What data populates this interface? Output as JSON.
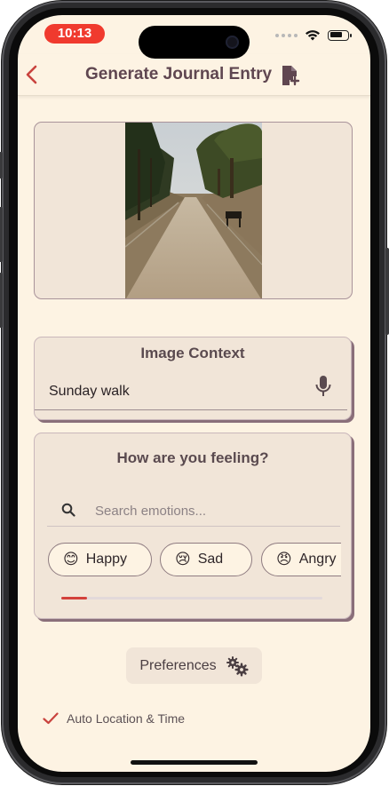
{
  "status_bar": {
    "time": "10:13"
  },
  "header": {
    "title": "Generate Journal Entry"
  },
  "image_context": {
    "title": "Image Context",
    "value": "Sunday walk"
  },
  "feelings": {
    "title": "How are you feeling?",
    "search_placeholder": "Search emotions...",
    "chips": [
      {
        "emoji": "😊",
        "label": "Happy"
      },
      {
        "emoji": "😢",
        "label": "Sad"
      },
      {
        "emoji": "😠",
        "label": "Angry"
      }
    ],
    "scroll_progress": 0.1
  },
  "preferences": {
    "label": "Preferences"
  },
  "auto_location": {
    "label": "Auto Location & Time",
    "checked": true
  },
  "colors": {
    "accent": "#d3413b",
    "background": "#fdf3e3",
    "card": "#f1e5d8",
    "title_text": "#5f4650"
  }
}
